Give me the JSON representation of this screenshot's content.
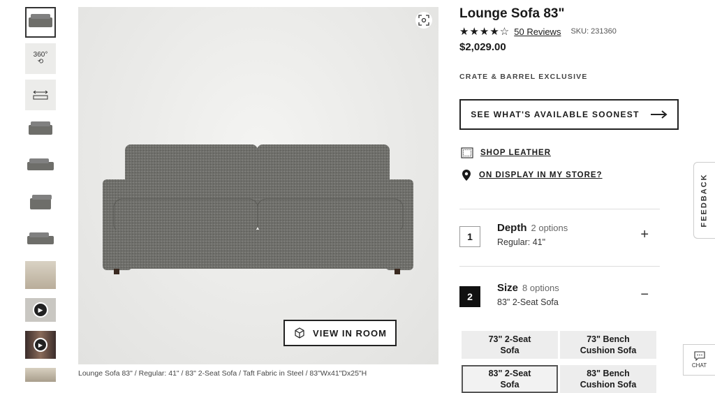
{
  "product": {
    "title": "Lounge Sofa 83\"",
    "rating_stars": "★★★★☆",
    "reviews_label": "50 Reviews",
    "sku": "SKU: 231360",
    "price": "$2,029.00",
    "exclusive": "CRATE & BARREL EXCLUSIVE",
    "caption": "Lounge Sofa 83\" / Regular: 41\" / 83\" 2-Seat Sofa / Taft Fabric in Steel / 83\"Wx41\"Dx25\"H"
  },
  "gallery": {
    "thumb_360_label": "360°",
    "view_in_room_label": "VIEW IN ROOM",
    "thumbnails": [
      "sofa-front",
      "360-view",
      "dimensions",
      "sofa-front-2",
      "sofa-angle",
      "sofa-side",
      "sofa-back",
      "room-scene",
      "video",
      "video-person",
      "room-scene-2"
    ]
  },
  "actions": {
    "availability_label": "SEE WHAT'S AVAILABLE SOONEST",
    "shop_leather_label": "SHOP LEATHER",
    "on_display_label": "ON DISPLAY IN MY STORE?"
  },
  "options": [
    {
      "number": "1",
      "name": "Depth",
      "count": "2 options",
      "value": "Regular: 41\"",
      "toggle": "+"
    },
    {
      "number": "2",
      "name": "Size",
      "count": "8 options",
      "value": "83\" 2-Seat Sofa",
      "toggle": "−"
    }
  ],
  "sizes": [
    {
      "label": "73\" 2-Seat Sofa",
      "line1": "73\" 2-Seat",
      "line2": "Sofa"
    },
    {
      "label": "73\" Bench Cushion Sofa",
      "line1": "73\" Bench",
      "line2": "Cushion Sofa"
    },
    {
      "label": "83\" 2-Seat Sofa",
      "line1": "83\" 2-Seat",
      "line2": "Sofa"
    },
    {
      "label": "83\" Bench Cushion Sofa",
      "line1": "83\" Bench",
      "line2": "Cushion Sofa"
    }
  ],
  "side": {
    "feedback_label": "FEEDBACK",
    "chat_label": "CHAT"
  },
  "colors": {
    "fabric": "#6e6e6b",
    "text": "#1a1a1a",
    "cell_bg": "#ededed"
  }
}
